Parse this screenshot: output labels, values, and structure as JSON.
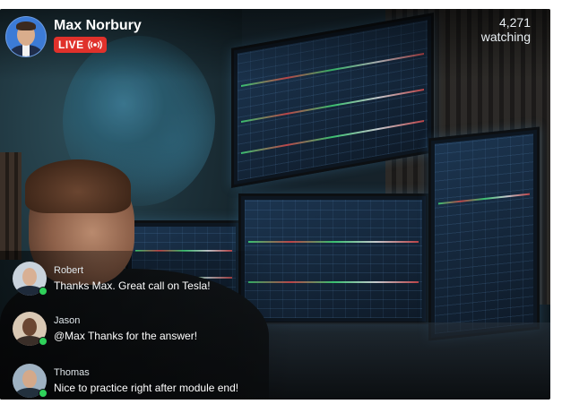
{
  "host": {
    "name": "Max Norbury",
    "live_label": "LIVE",
    "live_color": "#e0312b"
  },
  "viewers": {
    "count": "4,271",
    "label": "watching"
  },
  "chat": [
    {
      "user": "Robert",
      "message": "Thanks Max. Great call on Tesla!",
      "online": true
    },
    {
      "user": "Jason",
      "message": "@Max Thanks for the answer!",
      "online": true
    },
    {
      "user": "Thomas",
      "message": "Nice to practice right after module end!",
      "online": true
    }
  ],
  "icons": {
    "live": "broadcast-icon",
    "online": "online-status-dot"
  },
  "colors": {
    "online": "#2fd15a"
  }
}
